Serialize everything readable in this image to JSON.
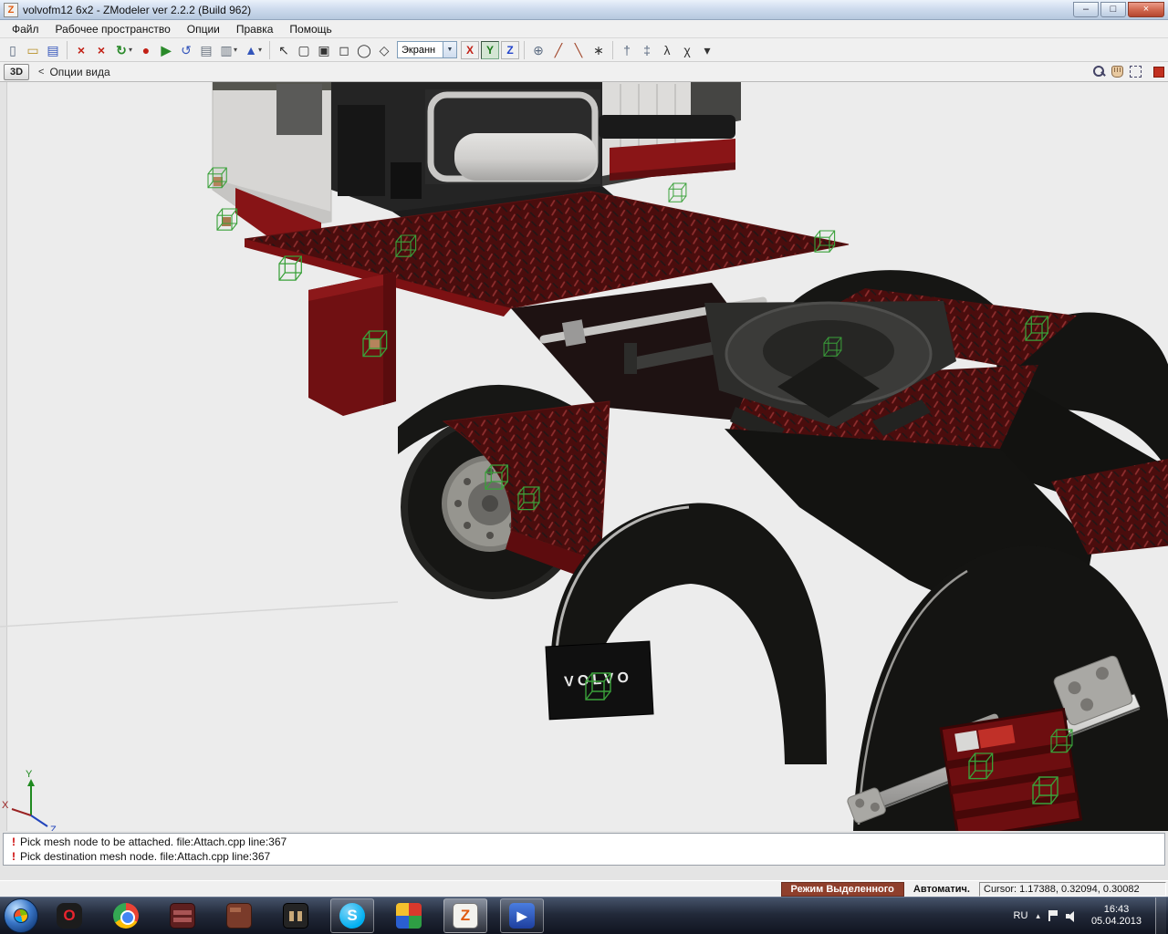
{
  "colors": {
    "selection_green": "#3aa13a",
    "chassis_red": "#7c1113",
    "deck_plate_red": "#4a0d0d",
    "status_mode_bg": "#8f3f2c",
    "viewport_bg": "#ececec",
    "taskbar_bg": "#1b2230"
  },
  "window": {
    "title": "volvofm12 6x2 - ZModeler ver 2.2.2 (Build 962)",
    "icon_letter": "Z",
    "minimize": "–",
    "maximize": "□",
    "close": "×"
  },
  "menu": {
    "items": [
      {
        "label": "Файл"
      },
      {
        "label": "Рабочее пространство"
      },
      {
        "label": "Опции"
      },
      {
        "label": "Правка"
      },
      {
        "label": "Помощь"
      }
    ]
  },
  "toolbar": {
    "caret": "▾",
    "view_mode_value": "Экранн",
    "view_mode_caret": "▼",
    "axis_x": "X",
    "axis_y": "Y",
    "axis_z": "Z",
    "icons": [
      {
        "name": "new-file",
        "glyph": "▯"
      },
      {
        "name": "open-file",
        "glyph": "▭"
      },
      {
        "name": "save-file",
        "glyph": "▤"
      },
      {
        "name": "delete",
        "glyph": "×"
      },
      {
        "name": "detach",
        "glyph": "×"
      },
      {
        "name": "refresh",
        "glyph": "↻"
      },
      {
        "name": "record",
        "glyph": "●"
      },
      {
        "name": "export",
        "glyph": "▶"
      },
      {
        "name": "undo",
        "glyph": "↺"
      },
      {
        "name": "notes",
        "glyph": "▤"
      },
      {
        "name": "script",
        "glyph": "▥"
      },
      {
        "name": "axes-widget",
        "glyph": "▲"
      },
      {
        "name": "select-pointer",
        "glyph": "↖"
      },
      {
        "name": "select-rectangle",
        "glyph": "▢"
      },
      {
        "name": "select-filled",
        "glyph": "▣"
      },
      {
        "name": "select-square",
        "glyph": "◻"
      },
      {
        "name": "select-circle",
        "glyph": "◯"
      },
      {
        "name": "select-polygon",
        "glyph": "◇"
      },
      {
        "name": "orbit-tool",
        "glyph": "⊕"
      },
      {
        "name": "knife-tool",
        "glyph": "╱"
      },
      {
        "name": "axe-tool",
        "glyph": "╲"
      },
      {
        "name": "pin-tool",
        "glyph": "∗"
      },
      {
        "name": "bone-tool",
        "glyph": "†"
      },
      {
        "name": "ik-tool",
        "glyph": "‡"
      },
      {
        "name": "walk-anim-tool",
        "glyph": "λ"
      },
      {
        "name": "figure-tool",
        "glyph": "χ"
      },
      {
        "name": "more-tools",
        "glyph": "▾"
      }
    ]
  },
  "viewbar": {
    "mode": "3D",
    "collapse": "<",
    "options_label": "Опции вида"
  },
  "viewport": {
    "mudflap_text": "VOLVO",
    "axis_labels": {
      "x": "X",
      "y": "Y",
      "z": "Z"
    }
  },
  "log": {
    "entries": [
      {
        "text": "Pick mesh node to be attached. file:Attach.cpp line:367"
      },
      {
        "text": "Pick destination mesh node. file:Attach.cpp line:367"
      }
    ]
  },
  "statusbar": {
    "mode": "Режим Выделенного",
    "auto": "Автоматич.",
    "cursor": "Cursor: 1.17388, 0.32094, 0.30082"
  },
  "taskbar": {
    "apps": [
      {
        "name": "opera",
        "letter": "O"
      },
      {
        "name": "chrome",
        "letter": ""
      },
      {
        "name": "archive",
        "letter": ""
      },
      {
        "name": "folder",
        "letter": ""
      },
      {
        "name": "game",
        "letter": ""
      },
      {
        "name": "skype",
        "letter": "S"
      },
      {
        "name": "player-grid",
        "letter": ""
      },
      {
        "name": "zmodeler",
        "letter": "Z"
      },
      {
        "name": "media",
        "letter": "▶"
      }
    ],
    "tray": {
      "hidden_icons": "▴",
      "language": "RU",
      "time": "16:43",
      "date": "05.04.2013"
    }
  }
}
